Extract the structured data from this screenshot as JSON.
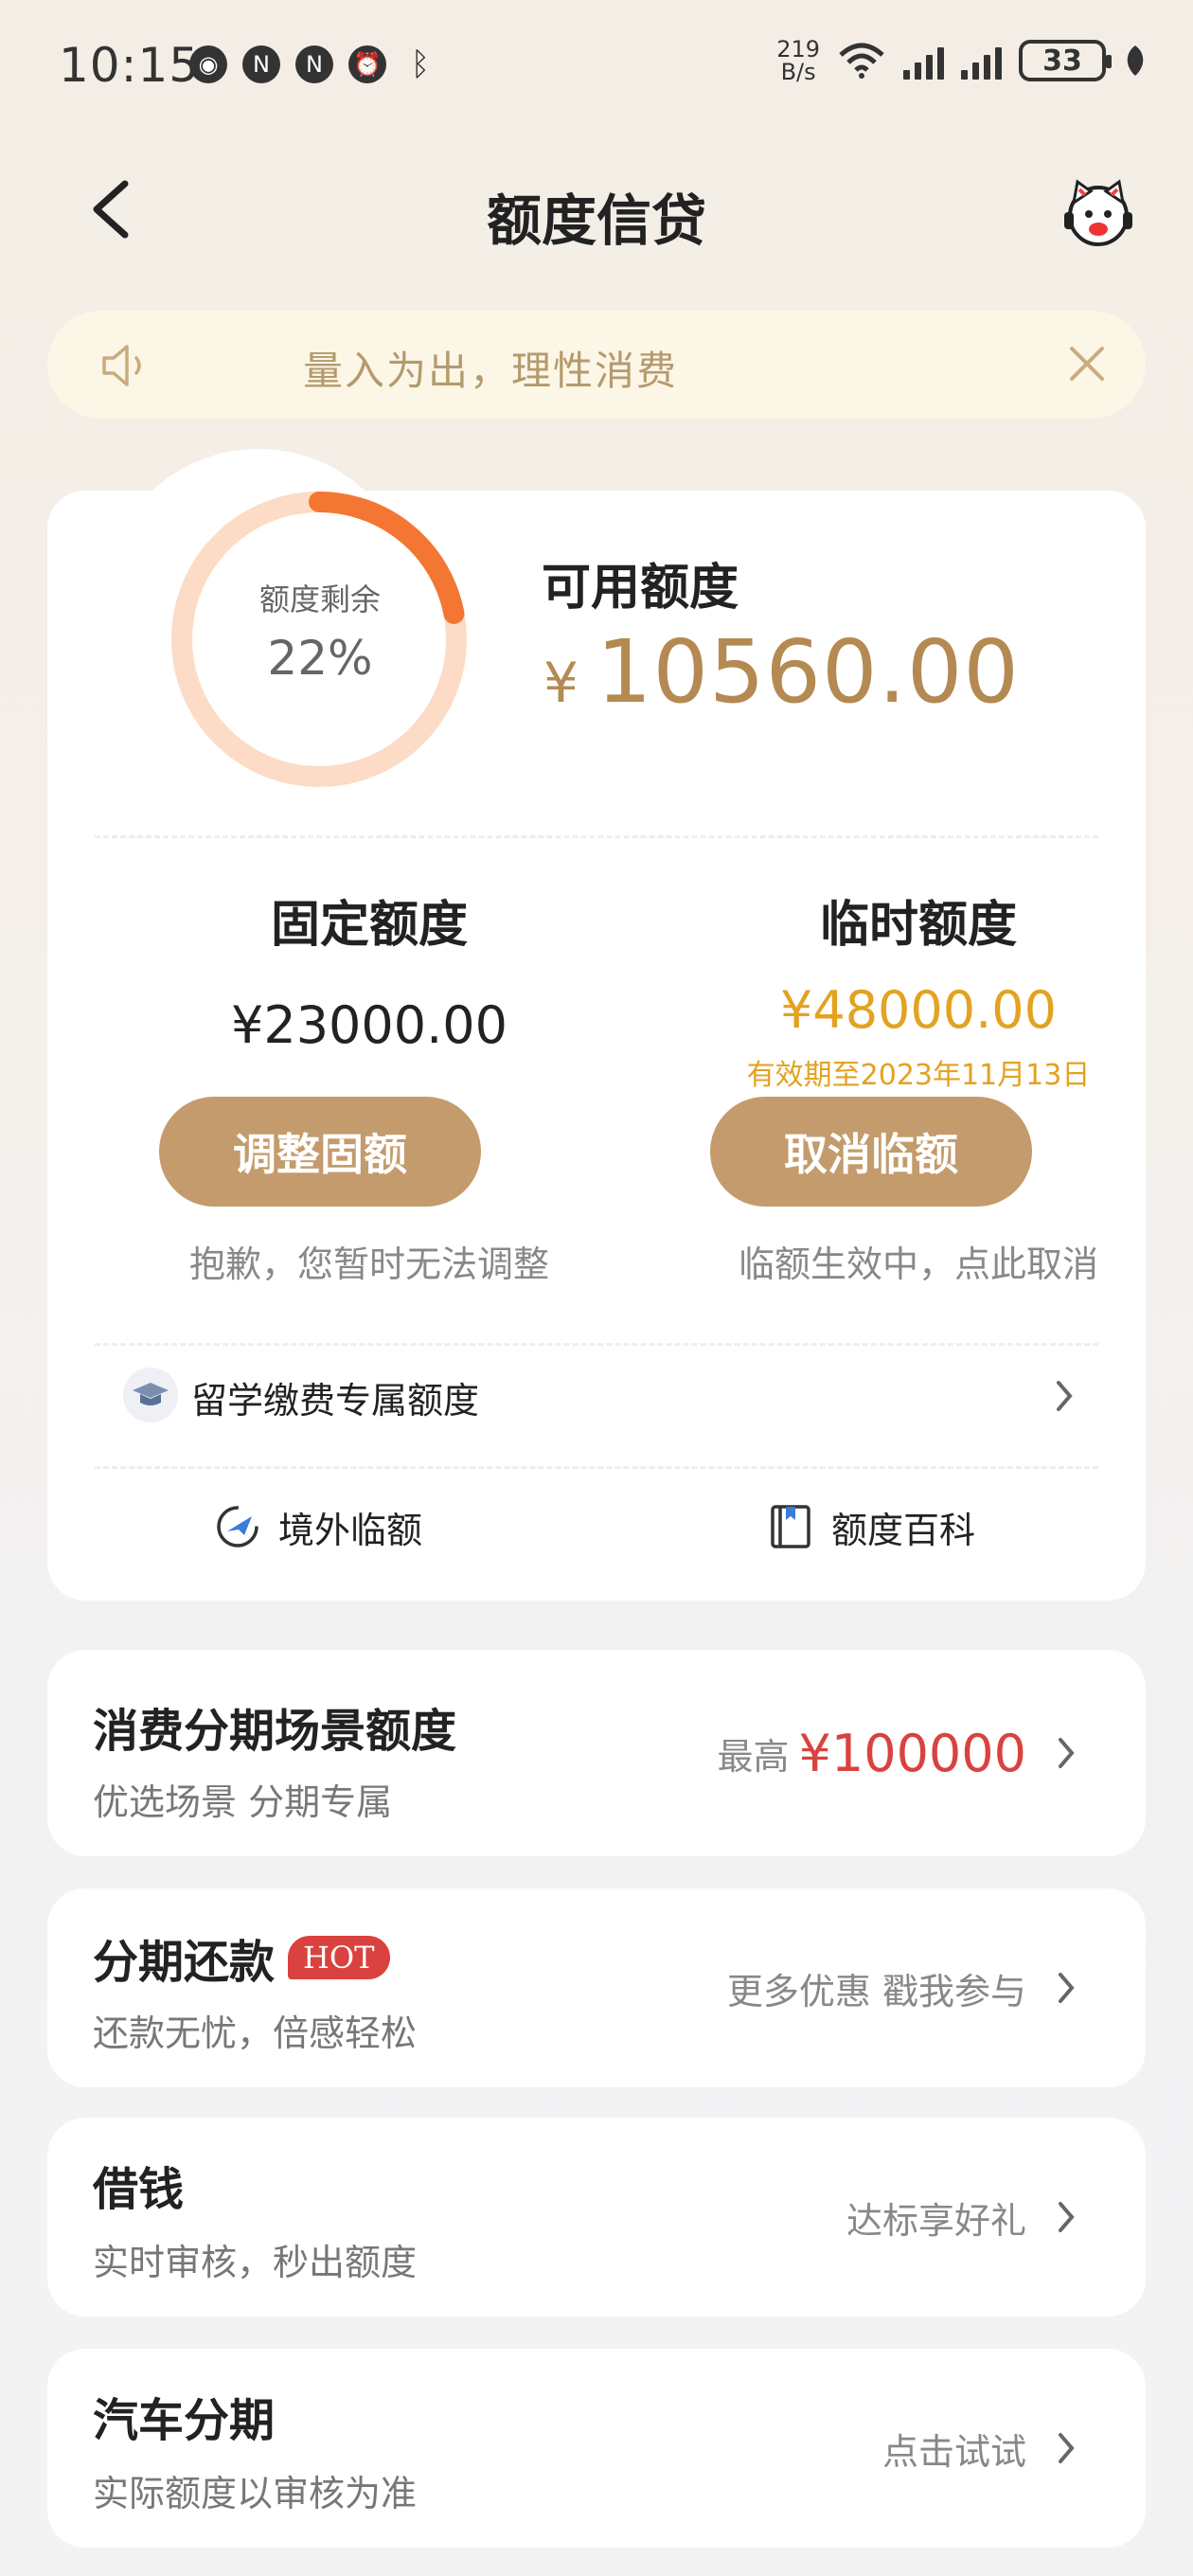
{
  "status_bar": {
    "time": "10:15",
    "net_speed_value": "219",
    "net_speed_unit": "B/s",
    "battery": "33",
    "icons": [
      "qq-icon",
      "nfc-circle-icon",
      "nfc-icon",
      "alarm-icon",
      "bluetooth-icon"
    ]
  },
  "header": {
    "title": "额度信贷"
  },
  "notice": {
    "text": "量入为出，理性消费"
  },
  "credit": {
    "ring_label": "额度剩余",
    "ring_percent_text": "22%",
    "ring_fraction": 0.22,
    "available_label": "可用额度",
    "available_currency": "¥",
    "available_amount": "10560.00",
    "fixed": {
      "title": "固定额度",
      "amount": "¥23000.00",
      "button": "调整固额",
      "hint": "抱歉，您暂时无法调整"
    },
    "temp": {
      "title": "临时额度",
      "amount": "¥48000.00",
      "validity": "有效期至2023年11月13日",
      "button": "取消临额",
      "hint": "临额生效中，点此取消"
    },
    "study_row": "留学缴费专属额度",
    "links": {
      "overseas": "境外临额",
      "encyclopedia": "额度百科"
    }
  },
  "cards": {
    "installment": {
      "title": "消费分期场景额度",
      "subtitle": "优选场景 分期专属",
      "right_prefix": "最高",
      "right_value": "¥100000"
    },
    "repay": {
      "title": "分期还款",
      "badge": "HOT",
      "subtitle": "还款无忧，倍感轻松",
      "right": "更多优惠 戳我参与"
    },
    "borrow": {
      "title": "借钱",
      "subtitle": "实时审核，秒出额度",
      "right": "达标享好礼"
    },
    "car": {
      "title": "汽车分期",
      "subtitle": "实际额度以审核为准",
      "right": "点击试试"
    }
  },
  "colors": {
    "gold": "#b48a52",
    "button": "#c49b6c",
    "ring_track": "#fcdcc6",
    "ring_fill": "#f37732",
    "temp_amount": "#e3a220",
    "red": "#d9423e"
  }
}
